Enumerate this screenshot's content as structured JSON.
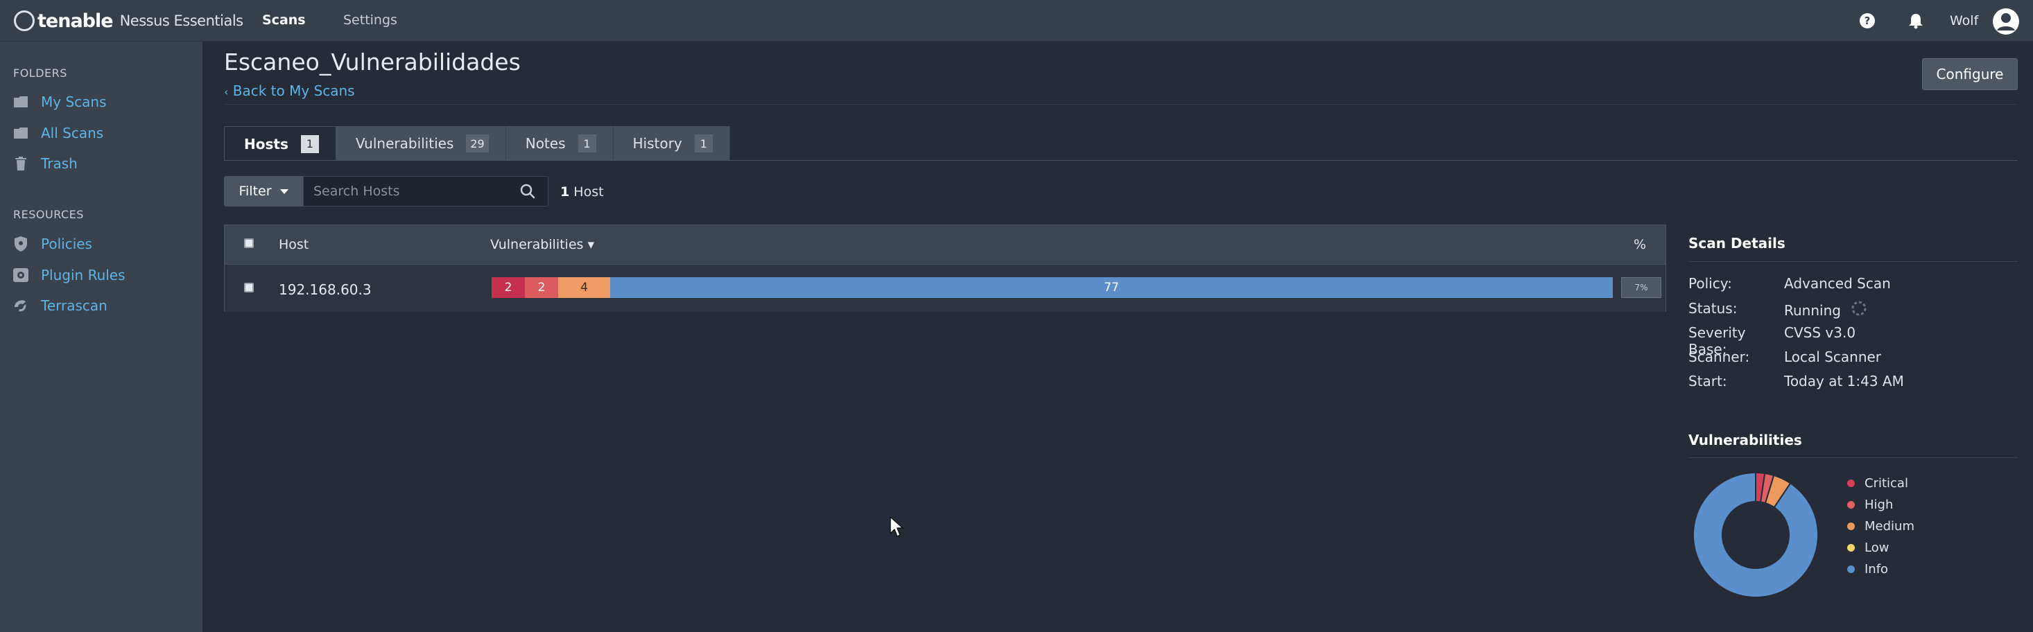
{
  "nav": {
    "brand": "tenable",
    "product": "Nessus Essentials",
    "links": [
      "Scans",
      "Settings"
    ],
    "user": "Wolf"
  },
  "sidebar": {
    "folders_heading": "FOLDERS",
    "folders": [
      {
        "label": "My Scans",
        "icon": "folder-icon"
      },
      {
        "label": "All Scans",
        "icon": "folder-icon"
      },
      {
        "label": "Trash",
        "icon": "trash-icon"
      }
    ],
    "resources_heading": "RESOURCES",
    "resources": [
      {
        "label": "Policies",
        "icon": "policy-shield-icon"
      },
      {
        "label": "Plugin Rules",
        "icon": "plugin-rules-icon"
      },
      {
        "label": "Terrascan",
        "icon": "terrascan-icon"
      }
    ]
  },
  "page": {
    "title": "Escaneo_Vulnerabilidades",
    "back_link": "Back to My Scans",
    "configure": "Configure"
  },
  "tabs": [
    {
      "label": "Hosts",
      "count": "1",
      "active": true
    },
    {
      "label": "Vulnerabilities",
      "count": "29",
      "active": false
    },
    {
      "label": "Notes",
      "count": "1",
      "active": false
    },
    {
      "label": "History",
      "count": "1",
      "active": false
    }
  ],
  "filter": {
    "label": "Filter",
    "search_placeholder": "Search Hosts",
    "result_count": "1",
    "result_unit": "Host"
  },
  "table": {
    "headers": {
      "host": "Host",
      "vulnerabilities": "Vulnerabilities ▾",
      "percent": "%"
    },
    "rows": [
      {
        "host": "192.168.60.3",
        "severity_counts": [
          {
            "severity": "Critical",
            "value": "2"
          },
          {
            "severity": "High",
            "value": "2"
          },
          {
            "severity": "Medium",
            "value": "4"
          },
          {
            "severity": "Info",
            "value": "77"
          }
        ],
        "progress": "7%"
      }
    ]
  },
  "scan_details": {
    "title": "Scan Details",
    "rows": [
      {
        "key": "Policy:",
        "value": "Advanced Scan"
      },
      {
        "key": "Status:",
        "value": "Running"
      },
      {
        "key": "Severity Base:",
        "value": "CVSS v3.0"
      },
      {
        "key": "Scanner:",
        "value": "Local Scanner"
      },
      {
        "key": "Start:",
        "value": "Today at 1:43 AM"
      }
    ]
  },
  "vulnerabilities_panel": {
    "title": "Vulnerabilities",
    "legend": [
      {
        "label": "Critical",
        "color": "#d43f5b"
      },
      {
        "label": "High",
        "color": "#e06064"
      },
      {
        "label": "Medium",
        "color": "#ee9a5d"
      },
      {
        "label": "Low",
        "color": "#f7d66a"
      },
      {
        "label": "Info",
        "color": "#5b8fcc"
      }
    ]
  },
  "colors": {
    "critical": "#c6304f",
    "high": "#dc5b5e",
    "medium": "#ef9b63",
    "low": "#f7d66a",
    "info": "#5c8fca",
    "link": "#5db4e6"
  }
}
